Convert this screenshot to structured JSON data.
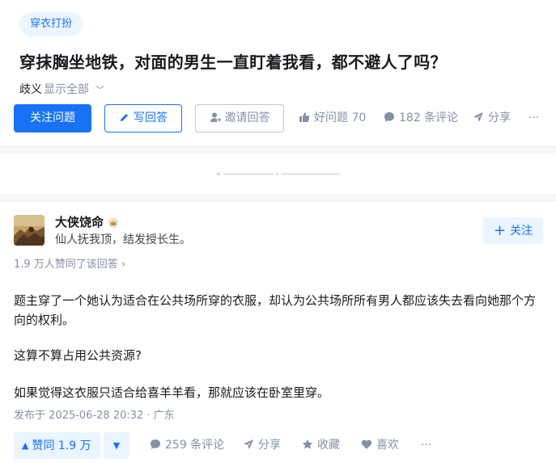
{
  "question": {
    "topic_tag": "穿衣打扮",
    "title": "穿抹胸坐地铁，对面的男生一直盯着我看，都不避人了吗？",
    "excerpt": "歧义",
    "show_all": "显示全部",
    "buttons": {
      "follow": "关注问题",
      "write_answer": "写回答",
      "invite": "邀请回答"
    },
    "meta": {
      "good_question": "好问题 70",
      "comments": "182 条评论",
      "share": "分享",
      "more": "···"
    }
  },
  "answer": {
    "author": {
      "name": "大侠饶命",
      "bio": "仙人抚我顶，结发授长生。",
      "follow_button": "关注"
    },
    "upvote_summary": "1.9 万人赞同了该回答",
    "paragraphs": [
      "题主穿了一个她认为适合在公共场所穿的衣服，却认为公共场所所有男人都应该失去看向她那个方向的权利。",
      "这算不算占用公共资源?",
      "如果觉得这衣服只适合给喜羊羊看，那就应该在卧室里穿。"
    ],
    "published": "发布于 2025-06-28 20:32 · 广东",
    "actions": {
      "upvote": "赞同 1.9 万",
      "comments": "259 条评论",
      "share": "分享",
      "collect": "收藏",
      "like": "喜欢",
      "more": "···"
    }
  },
  "icons": {
    "pencil": "pencil-icon",
    "invite": "invite-user-icon",
    "thumb": "thumbs-up-icon",
    "comment": "comment-bubble-icon",
    "share": "paper-plane-icon",
    "star": "star-icon",
    "heart": "heart-icon"
  },
  "colors": {
    "brand_blue": "#1772f6",
    "light_blue_bg": "#ebf5ff",
    "muted_text": "#8590a6",
    "page_bg": "#f6f6f6"
  }
}
